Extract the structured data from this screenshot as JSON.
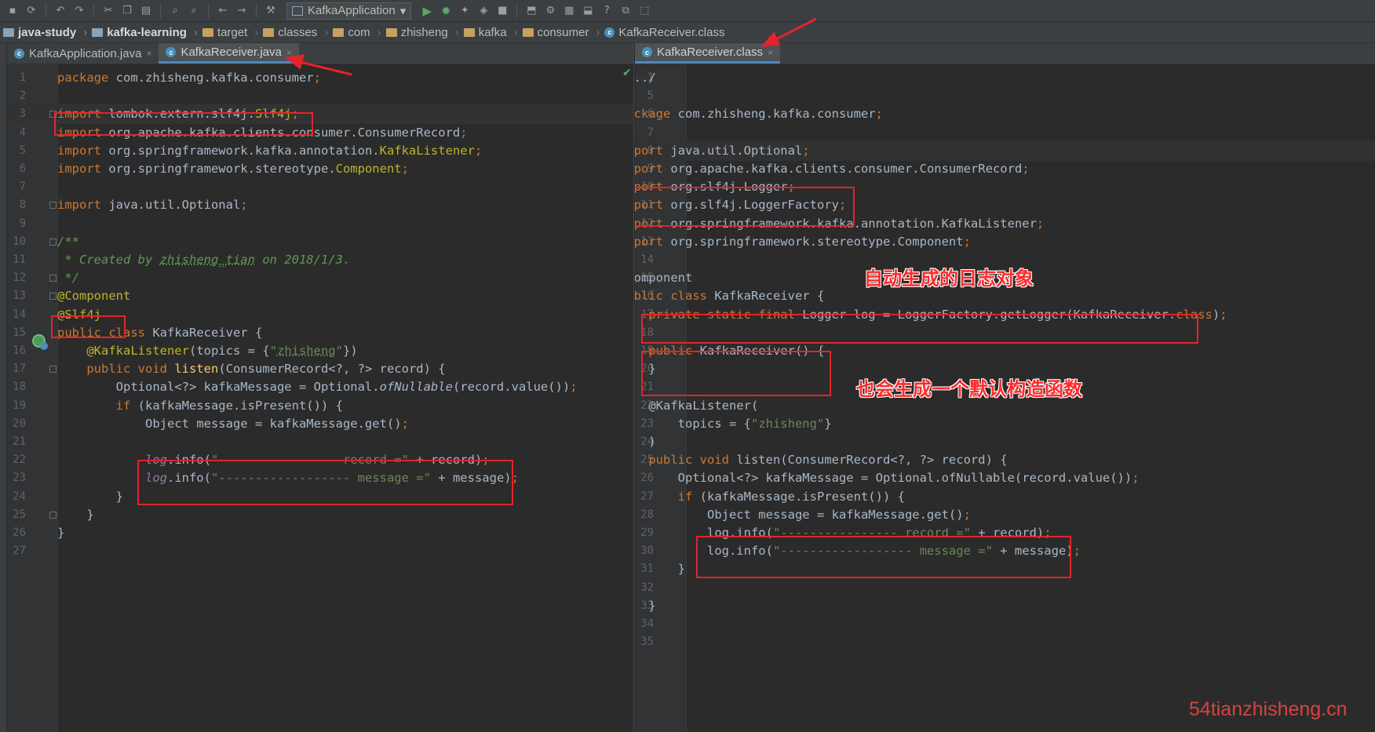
{
  "toolbar": {
    "run_config": "KafkaApplication"
  },
  "breadcrumb": [
    "java-study",
    "kafka-learning",
    "target",
    "classes",
    "com",
    "zhisheng",
    "kafka",
    "consumer",
    "KafkaReceiver.class"
  ],
  "left_tabs": [
    {
      "label": "KafkaApplication.java"
    },
    {
      "label": "KafkaReceiver.java"
    }
  ],
  "right_tabs": [
    {
      "label": "KafkaReceiver.class"
    }
  ],
  "left_lines": [
    {
      "n": "1",
      "t": [
        [
          "kw",
          "package "
        ],
        [
          "",
          "com.zhisheng.kafka.consumer"
        ],
        [
          "kw",
          ";"
        ]
      ]
    },
    {
      "n": "2",
      "t": []
    },
    {
      "n": "3",
      "t": [
        [
          "kw",
          "import "
        ],
        [
          "",
          "lombok.extern.slf4j."
        ],
        [
          "ann",
          "Slf4j"
        ],
        [
          "kw",
          ";"
        ]
      ]
    },
    {
      "n": "4",
      "t": [
        [
          "kw",
          "import "
        ],
        [
          "",
          "org.apache.kafka.clients.consumer.ConsumerRecord"
        ],
        [
          "kw",
          ";"
        ]
      ]
    },
    {
      "n": "5",
      "t": [
        [
          "kw",
          "import "
        ],
        [
          "",
          "org.springframework.kafka.annotation."
        ],
        [
          "ann",
          "KafkaListener"
        ],
        [
          "kw",
          ";"
        ]
      ]
    },
    {
      "n": "6",
      "t": [
        [
          "kw",
          "import "
        ],
        [
          "",
          "org.springframework.stereotype."
        ],
        [
          "ann",
          "Component"
        ],
        [
          "kw",
          ";"
        ]
      ]
    },
    {
      "n": "7",
      "t": []
    },
    {
      "n": "8",
      "t": [
        [
          "kw",
          "import "
        ],
        [
          "",
          "java.util.Optional"
        ],
        [
          "kw",
          ";"
        ]
      ]
    },
    {
      "n": "9",
      "t": []
    },
    {
      "n": "10",
      "t": [
        [
          "cmt",
          "/**"
        ]
      ]
    },
    {
      "n": "11",
      "t": [
        [
          "cmt",
          " * Created by "
        ],
        [
          "cmt under",
          "zhisheng_tian"
        ],
        [
          "cmt",
          " on 2018/1/3."
        ]
      ]
    },
    {
      "n": "12",
      "t": [
        [
          "cmt",
          " */"
        ]
      ]
    },
    {
      "n": "13",
      "t": [
        [
          "ann",
          "@Component"
        ]
      ]
    },
    {
      "n": "14",
      "t": [
        [
          "ann",
          "@Slf4j"
        ]
      ]
    },
    {
      "n": "15",
      "t": [
        [
          "kw",
          "public class "
        ],
        [
          "",
          "KafkaReceiver {"
        ]
      ]
    },
    {
      "n": "16",
      "t": [
        [
          "",
          "    "
        ],
        [
          "ann",
          "@KafkaListener"
        ],
        [
          "",
          "(topics = {"
        ],
        [
          "str",
          "\""
        ],
        [
          "str under",
          "zhisheng"
        ],
        [
          "str",
          "\""
        ],
        [
          "",
          "})"
        ]
      ]
    },
    {
      "n": "17",
      "t": [
        [
          "",
          "    "
        ],
        [
          "kw",
          "public void "
        ],
        [
          "fn",
          "listen"
        ],
        [
          "",
          "(ConsumerRecord<?, ?> record) {"
        ]
      ]
    },
    {
      "n": "18",
      "t": [
        [
          "",
          "        Optional<?> kafkaMessage = Optional."
        ],
        [
          "italic",
          "ofNullable"
        ],
        [
          "",
          "(record.value())"
        ],
        [
          "kw",
          ";"
        ]
      ]
    },
    {
      "n": "19",
      "t": [
        [
          "",
          "        "
        ],
        [
          "kw",
          "if "
        ],
        [
          "",
          "(kafkaMessage.isPresent()) {"
        ]
      ]
    },
    {
      "n": "20",
      "t": [
        [
          "",
          "            Object message = kafkaMessage.get()"
        ],
        [
          "kw",
          ";"
        ]
      ]
    },
    {
      "n": "21",
      "t": []
    },
    {
      "n": "22",
      "t": [
        [
          "",
          "            "
        ],
        [
          "fld",
          "log"
        ],
        [
          "",
          ".info("
        ],
        [
          "str",
          "\"---------------- record =\""
        ],
        [
          "",
          " + record)"
        ],
        [
          "kw",
          ";"
        ]
      ]
    },
    {
      "n": "23",
      "t": [
        [
          "",
          "            "
        ],
        [
          "fld",
          "log"
        ],
        [
          "",
          ".info("
        ],
        [
          "str",
          "\"------------------ message =\""
        ],
        [
          "",
          " + message)"
        ],
        [
          "kw",
          ";"
        ]
      ]
    },
    {
      "n": "24",
      "t": [
        [
          "",
          "        }"
        ]
      ]
    },
    {
      "n": "25",
      "t": [
        [
          "",
          "    }"
        ]
      ]
    },
    {
      "n": "26",
      "t": [
        [
          "",
          "}"
        ]
      ]
    },
    {
      "n": "27",
      "t": []
    }
  ],
  "right_lines": [
    {
      "n": "1",
      "t": [
        [
          "",
          "/.../"
        ]
      ]
    },
    {
      "n": "5",
      "t": []
    },
    {
      "n": "6",
      "t": [
        [
          "kw",
          "package "
        ],
        [
          "",
          "com.zhisheng.kafka.consumer"
        ],
        [
          "kw",
          ";"
        ]
      ]
    },
    {
      "n": "7",
      "t": []
    },
    {
      "n": "8",
      "t": [
        [
          "kw",
          "import "
        ],
        [
          "",
          "java.util.Optional"
        ],
        [
          "kw",
          ";"
        ]
      ]
    },
    {
      "n": "9",
      "t": [
        [
          "kw",
          "import "
        ],
        [
          "",
          "org.apache.kafka.clients.consumer.ConsumerRecord"
        ],
        [
          "kw",
          ";"
        ]
      ]
    },
    {
      "n": "10",
      "t": [
        [
          "kw",
          "import "
        ],
        [
          "",
          "org.slf4j.Logger"
        ],
        [
          "kw",
          ";"
        ]
      ]
    },
    {
      "n": "11",
      "t": [
        [
          "kw",
          "import "
        ],
        [
          "",
          "org.slf4j.LoggerFactory"
        ],
        [
          "kw",
          ";"
        ]
      ]
    },
    {
      "n": "12",
      "t": [
        [
          "kw",
          "import "
        ],
        [
          "",
          "org.springframework.kafka.annotation.KafkaListener"
        ],
        [
          "kw",
          ";"
        ]
      ]
    },
    {
      "n": "13",
      "t": [
        [
          "kw",
          "import "
        ],
        [
          "",
          "org.springframework.stereotype.Component"
        ],
        [
          "kw",
          ";"
        ]
      ]
    },
    {
      "n": "14",
      "t": []
    },
    {
      "n": "15",
      "t": [
        [
          "",
          "@Component"
        ]
      ]
    },
    {
      "n": "16",
      "t": [
        [
          "kw",
          "public class "
        ],
        [
          "",
          "KafkaReceiver {"
        ]
      ]
    },
    {
      "n": "17",
      "t": [
        [
          "",
          "    "
        ],
        [
          "kw",
          "private static final "
        ],
        [
          "",
          "Logger log = LoggerFactory.getLogger(KafkaReceiver."
        ],
        [
          "kw",
          "class"
        ],
        [
          "",
          ")"
        ],
        [
          "kw",
          ";"
        ]
      ]
    },
    {
      "n": "18",
      "t": []
    },
    {
      "n": "19",
      "t": [
        [
          "",
          "    "
        ],
        [
          "kw",
          "public "
        ],
        [
          "",
          "KafkaReceiver() {"
        ]
      ]
    },
    {
      "n": "20",
      "t": [
        [
          "",
          "    }"
        ]
      ]
    },
    {
      "n": "21",
      "t": []
    },
    {
      "n": "22",
      "t": [
        [
          "",
          "    @KafkaListener("
        ]
      ]
    },
    {
      "n": "23",
      "t": [
        [
          "",
          "        topics = {"
        ],
        [
          "str",
          "\"zhisheng\""
        ],
        [
          "",
          "}"
        ]
      ]
    },
    {
      "n": "24",
      "t": [
        [
          "",
          "    )"
        ]
      ]
    },
    {
      "n": "25",
      "t": [
        [
          "",
          "    "
        ],
        [
          "kw",
          "public void "
        ],
        [
          "",
          "listen(ConsumerRecord<?, ?> record) {"
        ]
      ]
    },
    {
      "n": "26",
      "t": [
        [
          "",
          "        Optional<?> kafkaMessage = Optional.ofNullable(record.value())"
        ],
        [
          "kw",
          ";"
        ]
      ]
    },
    {
      "n": "27",
      "t": [
        [
          "",
          "        "
        ],
        [
          "kw",
          "if "
        ],
        [
          "",
          "(kafkaMessage.isPresent()) {"
        ]
      ]
    },
    {
      "n": "28",
      "t": [
        [
          "",
          "            Object message = kafkaMessage.get()"
        ],
        [
          "kw",
          ";"
        ]
      ]
    },
    {
      "n": "29",
      "t": [
        [
          "",
          "            log.info("
        ],
        [
          "str",
          "\"---------------- record =\""
        ],
        [
          "",
          " + record)"
        ],
        [
          "kw",
          ";"
        ]
      ]
    },
    {
      "n": "30",
      "t": [
        [
          "",
          "            log.info("
        ],
        [
          "str",
          "\"------------------ message =\""
        ],
        [
          "",
          " + message)"
        ],
        [
          "kw",
          ";"
        ]
      ]
    },
    {
      "n": "31",
      "t": [
        [
          "",
          "        }"
        ]
      ]
    },
    {
      "n": "32",
      "t": []
    },
    {
      "n": "33",
      "t": [
        [
          "",
          "    }"
        ]
      ]
    },
    {
      "n": "34",
      "t": [
        [
          "",
          "}"
        ]
      ]
    },
    {
      "n": "35",
      "t": []
    }
  ],
  "annotations": {
    "note_logger": "自动生成的日志对象",
    "note_constructor": "也会生成一个默认构造函数",
    "watermark": "54tianzhisheng.cn"
  },
  "colors": {
    "highlight_red": "#e3242b",
    "keyword": "#cc7832",
    "annotation": "#bbb529",
    "string": "#6a8759",
    "comment": "#629755"
  }
}
